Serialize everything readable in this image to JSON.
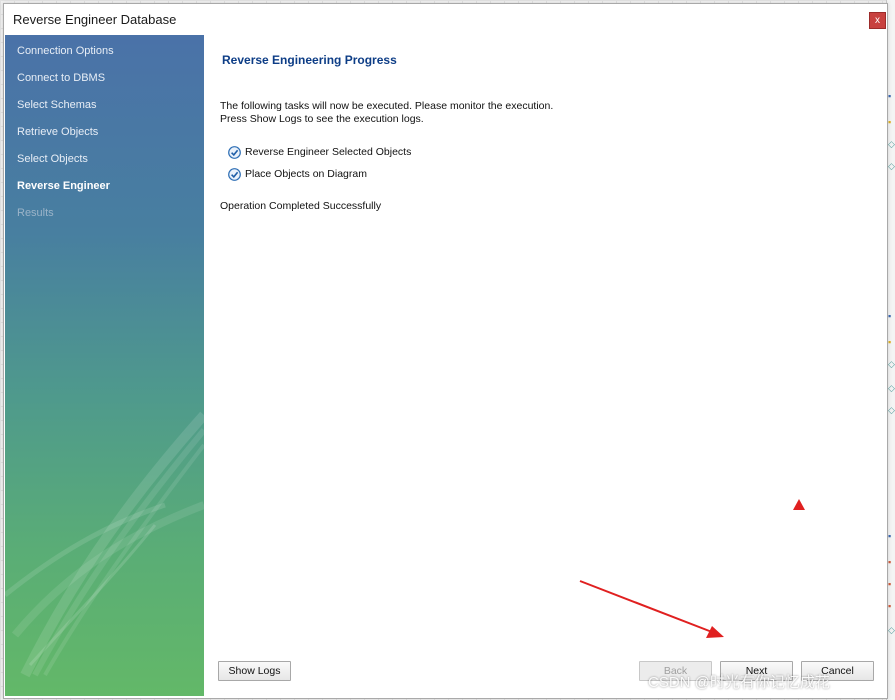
{
  "window": {
    "title": "Reverse Engineer Database",
    "close_label": "x"
  },
  "sidebar": {
    "steps": [
      {
        "label": "Connection Options",
        "state": "done"
      },
      {
        "label": "Connect to DBMS",
        "state": "done"
      },
      {
        "label": "Select Schemas",
        "state": "done"
      },
      {
        "label": "Retrieve Objects",
        "state": "done"
      },
      {
        "label": "Select Objects",
        "state": "done"
      },
      {
        "label": "Reverse Engineer",
        "state": "active"
      },
      {
        "label": "Results",
        "state": "pending"
      }
    ]
  },
  "main": {
    "title": "Reverse Engineering Progress",
    "description_line1": "The following tasks will now be executed. Please monitor the execution.",
    "description_line2": "Press Show Logs to see the execution logs.",
    "tasks": [
      {
        "label": "Reverse Engineer Selected Objects",
        "status": "completed"
      },
      {
        "label": "Place Objects on Diagram",
        "status": "completed"
      }
    ],
    "status_message": "Operation Completed Successfully"
  },
  "buttons": {
    "show_logs": "Show Logs",
    "back": "Back",
    "next": "Next",
    "cancel": "Cancel"
  },
  "watermark": "CSDN @时光有你记忆成花",
  "colors": {
    "accent_title": "#0d3d86",
    "close_button": "#c8413f",
    "annotation_arrow": "#e02020",
    "check_icon": "#2f6fb5"
  }
}
